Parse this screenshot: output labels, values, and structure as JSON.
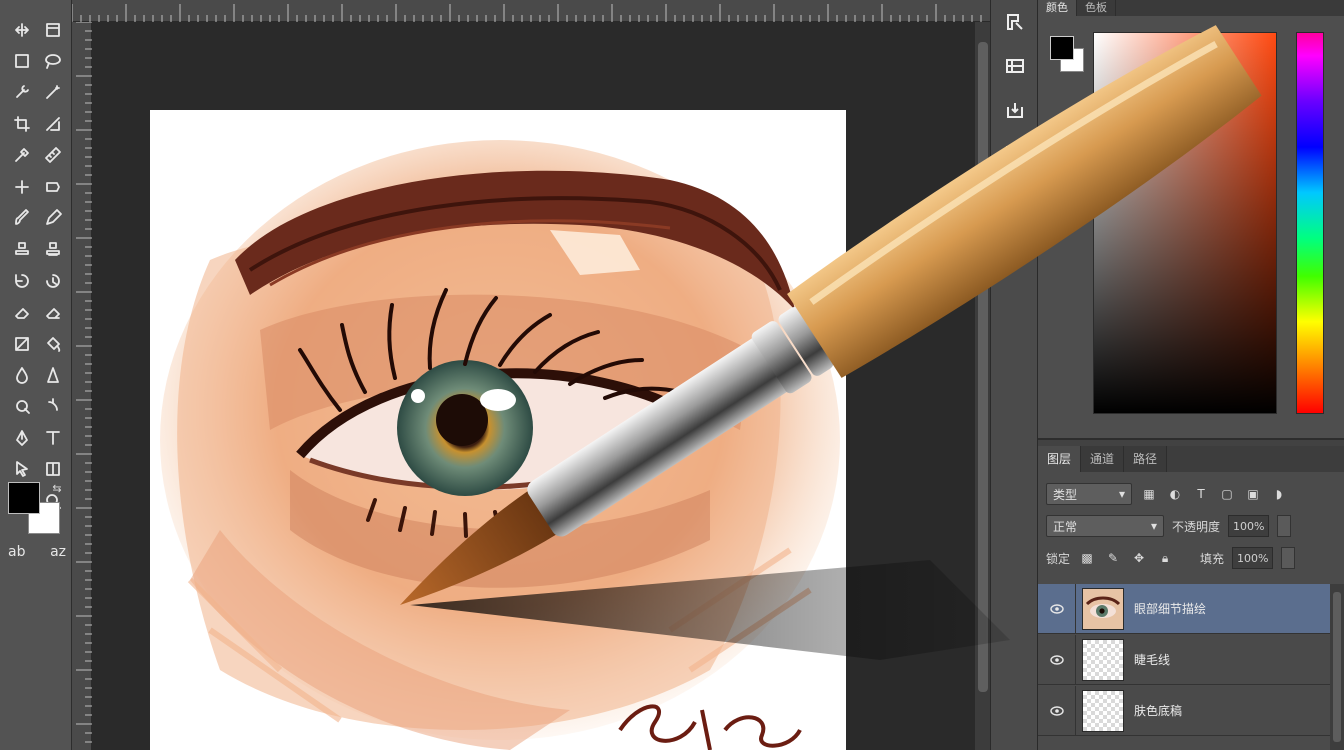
{
  "toolbox": {
    "tools": [
      {
        "name": "move-tool",
        "icon": "move-icon"
      },
      {
        "name": "artboard-tool",
        "icon": "artboard-icon"
      },
      {
        "name": "marquee-tool",
        "icon": "marquee-icon"
      },
      {
        "name": "lasso-tool",
        "icon": "lasso-icon"
      },
      {
        "name": "quick-select-tool",
        "icon": "quick-select-icon"
      },
      {
        "name": "magic-wand-tool",
        "icon": "magic-wand-icon"
      },
      {
        "name": "crop-tool",
        "icon": "crop-icon"
      },
      {
        "name": "slice-tool",
        "icon": "slice-icon"
      },
      {
        "name": "eyedropper-tool",
        "icon": "eyedropper-icon"
      },
      {
        "name": "ruler-tool",
        "icon": "ruler-icon"
      },
      {
        "name": "healing-brush-tool",
        "icon": "healing-brush-icon"
      },
      {
        "name": "patch-tool",
        "icon": "patch-icon"
      },
      {
        "name": "brush-tool",
        "icon": "brush-icon"
      },
      {
        "name": "pencil-tool",
        "icon": "pencil-icon"
      },
      {
        "name": "clone-stamp-tool",
        "icon": "clone-stamp-icon"
      },
      {
        "name": "pattern-stamp-tool",
        "icon": "pattern-stamp-icon"
      },
      {
        "name": "history-brush-tool",
        "icon": "history-brush-icon"
      },
      {
        "name": "art-history-brush-tool",
        "icon": "art-history-brush-icon"
      },
      {
        "name": "eraser-tool",
        "icon": "eraser-icon"
      },
      {
        "name": "background-eraser-tool",
        "icon": "background-eraser-icon"
      },
      {
        "name": "gradient-tool",
        "icon": "gradient-icon"
      },
      {
        "name": "paint-bucket-tool",
        "icon": "paint-bucket-icon"
      },
      {
        "name": "blur-tool",
        "icon": "blur-icon"
      },
      {
        "name": "sharpen-tool",
        "icon": "sharpen-icon"
      },
      {
        "name": "dodge-tool",
        "icon": "dodge-icon"
      },
      {
        "name": "burn-tool",
        "icon": "burn-icon"
      },
      {
        "name": "pen-tool",
        "icon": "pen-icon"
      },
      {
        "name": "type-tool",
        "icon": "type-icon"
      },
      {
        "name": "path-select-tool",
        "icon": "path-select-icon"
      },
      {
        "name": "shape-tool",
        "icon": "shape-icon"
      },
      {
        "name": "hand-tool",
        "icon": "hand-icon"
      },
      {
        "name": "zoom-tool",
        "icon": "zoom-icon"
      }
    ],
    "bottom": [
      "ab",
      "az"
    ]
  },
  "side_mini": [
    "brush-settings-icon",
    "brush-presets-icon",
    "clone-source-icon",
    "history-icon"
  ],
  "color_panel": {
    "tabs": [
      "颜色",
      "色板"
    ],
    "colors": {
      "foreground": "#000000",
      "background": "#ffffff",
      "field_hue": "#ff4a12"
    }
  },
  "layers_panel": {
    "tabs": [
      "图层",
      "通道",
      "路径"
    ],
    "filter_label": "类型",
    "blend_mode": "正常",
    "opacity_label": "不透明度",
    "opacity_value": "100%",
    "lock_label": "锁定",
    "fill_label": "填充",
    "fill_value": "100%",
    "layers": [
      {
        "name": "眼部细节描绘",
        "selected": true,
        "thumb": "eye"
      },
      {
        "name": "睫毛线",
        "selected": false,
        "thumb": "empty"
      },
      {
        "name": "肤色底稿",
        "selected": false,
        "thumb": "empty"
      }
    ]
  }
}
